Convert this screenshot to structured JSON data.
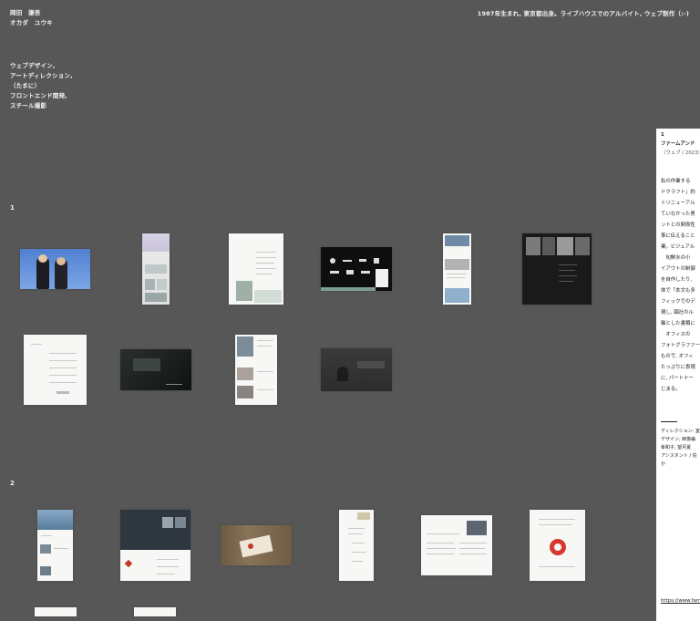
{
  "profile": {
    "name_kanji": "岡田　謙吾",
    "name_kana": "オカダ　ユウキ",
    "bio": "1987年生まれ, 東京都出身。ライブハウスでのアルバイト, ウェブ制作（:-)",
    "roles": [
      "ウェブデザイン,",
      "アートディレクション,",
      "（たまに）",
      "フロントエンド開発,",
      "スチール撮影"
    ]
  },
  "sections": [
    {
      "number": "1"
    },
    {
      "number": "2"
    }
  ],
  "detail_panel": {
    "index": "1",
    "title": "ファームアンド",
    "meta": "（ウェブ / 2023）",
    "body": [
      "私の作業する",
      "ドクラフト」約",
      "トリニューアル",
      "ていなかった男",
      "ントとの関係性",
      "事に伝えること",
      "業。ビジュアル",
      "　旬鮮水の小",
      "イアウトの制御",
      "を自作したり,",
      "体で「本文も多",
      "フィックでのデ",
      "現し, 図社のル",
      "軸とした書類に",
      "　オフィスの",
      "フォトグラファー",
      "もので, オフィ",
      "たっぷりに表現",
      "に, パートナー",
      "じまる。"
    ],
    "credits": [
      "ディレクション: 室",
      "デザイン, 映像編",
      "峯和子, 望月夏",
      "アシスタント / 佐",
      "か"
    ],
    "url": "https://www.fam"
  }
}
